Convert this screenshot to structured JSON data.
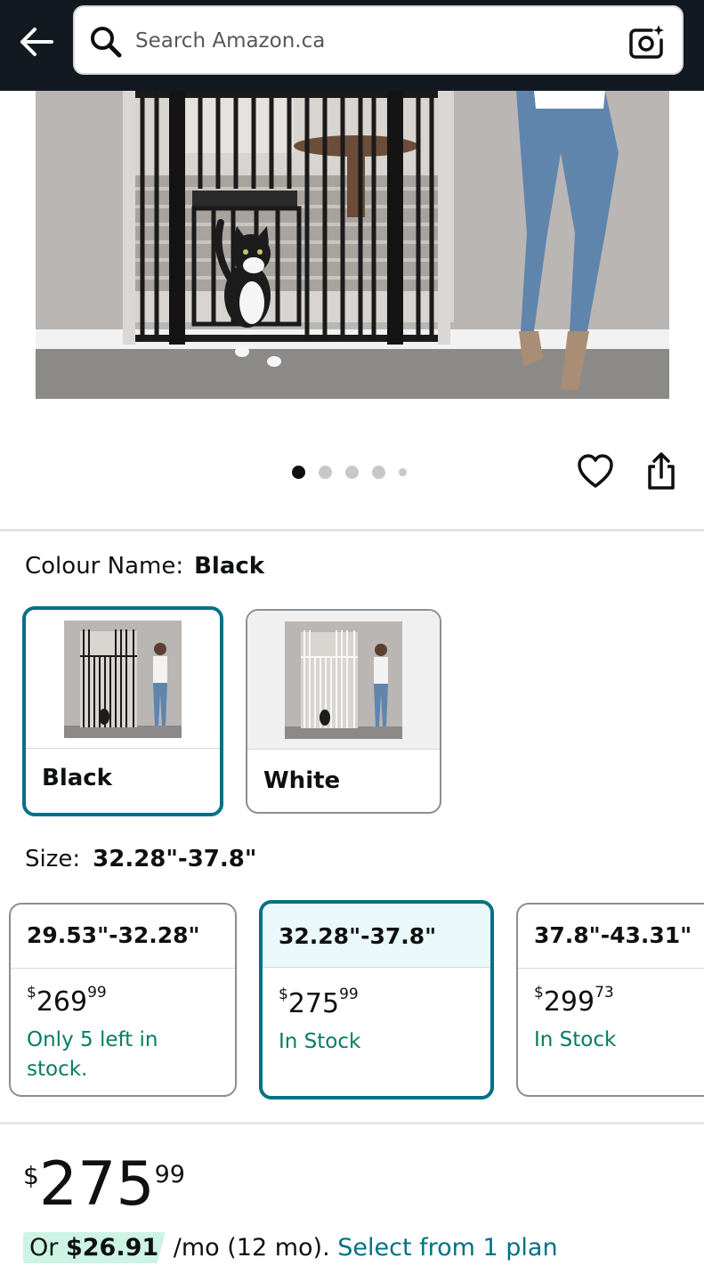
{
  "header": {
    "back_icon": "arrow-left-icon",
    "search_placeholder": "Search Amazon.ca",
    "search_icon": "search-icon",
    "camera_icon": "camera-lens-icon"
  },
  "gallery": {
    "image_count": 5,
    "active_index": 0,
    "wishlist_icon": "heart-icon",
    "share_icon": "share-icon"
  },
  "colour": {
    "label": "Colour Name:",
    "selected": "Black",
    "options": [
      {
        "name": "Black",
        "selected": true
      },
      {
        "name": "White",
        "selected": false
      }
    ]
  },
  "size": {
    "label": "Size:",
    "selected": "32.28\"-37.8\"",
    "options": [
      {
        "name": "29.53\"-32.28\"",
        "price_symbol": "$",
        "price_whole": "269",
        "price_cents": "99",
        "stock": "Only 5 left in stock.",
        "selected": false
      },
      {
        "name": "32.28\"-37.8\"",
        "price_symbol": "$",
        "price_whole": "275",
        "price_cents": "99",
        "stock": "In Stock",
        "selected": true
      },
      {
        "name": "37.8\"-43.31\"",
        "price_symbol": "$",
        "price_whole": "299",
        "price_cents": "73",
        "stock": "In Stock",
        "selected": false
      }
    ]
  },
  "buybox": {
    "currency": "$",
    "price_whole": "275",
    "price_cents": "99",
    "plan_or": "Or",
    "plan_amount": "$26.91",
    "plan_terms": " /mo (12 mo). ",
    "plan_link": "Select from 1 plan"
  },
  "colors": {
    "header_bg": "#131921",
    "accent_teal": "#007185",
    "stock_green": "#067d62",
    "plan_highlight": "#cdf3e5"
  }
}
